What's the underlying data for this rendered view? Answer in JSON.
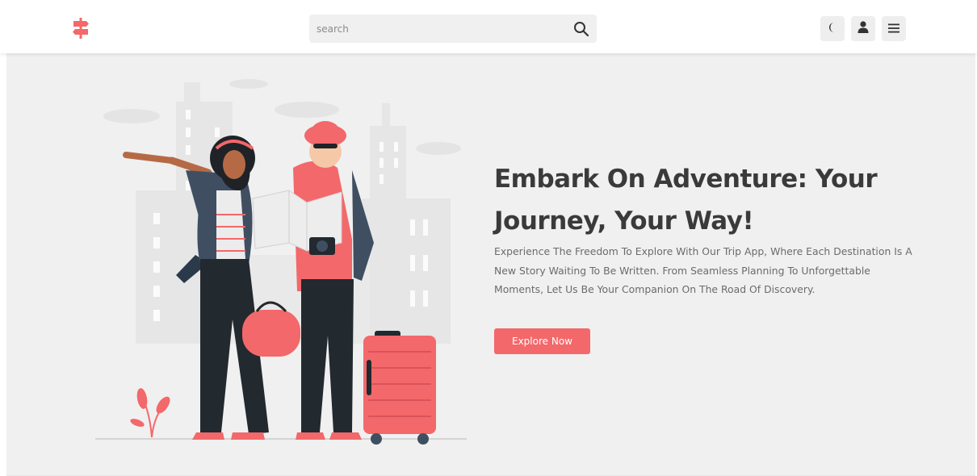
{
  "header": {
    "logo_icon": "signpost-icon",
    "search": {
      "placeholder": "search",
      "value": "",
      "icon": "search-icon"
    },
    "actions": [
      {
        "icon": "moon-icon",
        "label": "dark mode"
      },
      {
        "icon": "user-icon",
        "label": "account"
      },
      {
        "icon": "menu-icon",
        "label": "menu"
      }
    ]
  },
  "hero": {
    "title": "Embark On Adventure: Your Journey, Your Way!",
    "description": "Experience The Freedom To Explore With Our Trip App, Where Each Destination Is A New Story Waiting To Be Written. From Seamless Planning To Unforgettable Moments, Let Us Be Your Companion On The Road Of Discovery.",
    "cta_label": "Explore Now",
    "illustration": "travelers-with-map-and-suitcase"
  },
  "colors": {
    "accent": "#f3686a",
    "heading": "#3a3a3a",
    "body_text": "#6b6b6b",
    "hero_bg": "#f0f0f0"
  }
}
